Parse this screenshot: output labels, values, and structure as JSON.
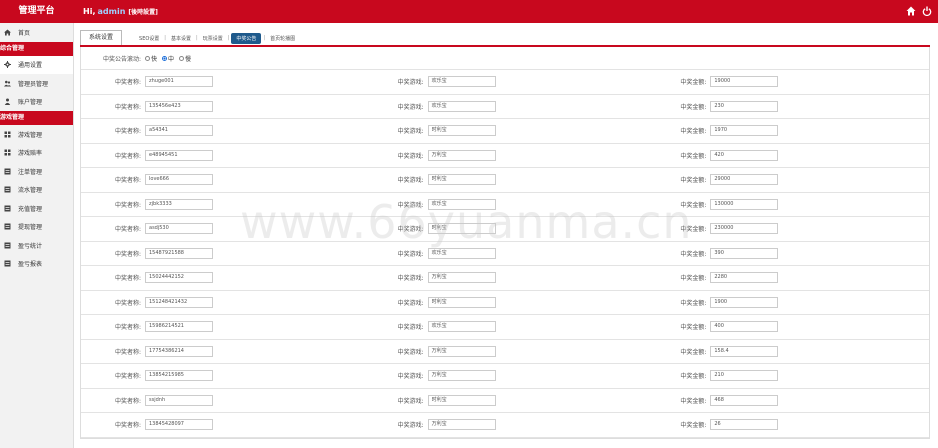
{
  "header": {
    "brand": "管理平台",
    "greet": "Hi,",
    "user": "admin",
    "role": "[後時設置]"
  },
  "sidebar": {
    "items": [
      {
        "label": "首页",
        "icon": "home-icon"
      },
      {
        "label": "综合管理",
        "head": true
      },
      {
        "label": "通用设置",
        "icon": "gear-icon",
        "active": true
      },
      {
        "label": "管理员管理",
        "icon": "users-icon"
      },
      {
        "label": "账户管理",
        "icon": "user-icon"
      },
      {
        "label": "游戏管理",
        "head": true
      },
      {
        "label": "游戏管理",
        "icon": "grid-icon"
      },
      {
        "label": "游戏赔率",
        "icon": "grid-icon"
      },
      {
        "label": "注单管理",
        "icon": "list-icon"
      },
      {
        "label": "流水管理",
        "icon": "list-icon"
      },
      {
        "label": "充值管理",
        "icon": "list-icon"
      },
      {
        "label": "提现管理",
        "icon": "list-icon"
      },
      {
        "label": "盈亏统计",
        "icon": "list-icon"
      },
      {
        "label": "盈亏报表",
        "icon": "list-icon"
      }
    ]
  },
  "tabs": {
    "main": "系统设置",
    "sub": [
      "SEO设置",
      "基本设置",
      "玩票设置",
      "中奖公告",
      "首页轮播图"
    ],
    "active_sub": 3
  },
  "toggle": {
    "label": "中奖公告滚动:",
    "options": [
      "快",
      "中",
      "慢"
    ],
    "selected": 1
  },
  "labels": {
    "name": "中奖者称:",
    "game": "中奖游戏:",
    "amount": "中奖金额:"
  },
  "rows": [
    {
      "name": "zhuge001",
      "game": "欢乐宝",
      "amount": "19000"
    },
    {
      "name": "135456e423",
      "game": "欢乐宝",
      "amount": "230"
    },
    {
      "name": "a54341",
      "game": "时利宝",
      "amount": "1970"
    },
    {
      "name": "e48945451",
      "game": "万利宝",
      "amount": "420"
    },
    {
      "name": "love666",
      "game": "时利宝",
      "amount": "29000"
    },
    {
      "name": "zjbk3333",
      "game": "欢乐宝",
      "amount": "130000"
    },
    {
      "name": "asdj530",
      "game": "时利宝",
      "amount": "230000"
    },
    {
      "name": "15487921588",
      "game": "欢乐宝",
      "amount": "390"
    },
    {
      "name": "15024442152",
      "game": "万利宝",
      "amount": "2280"
    },
    {
      "name": "151248421432",
      "game": "时利宝",
      "amount": "1900"
    },
    {
      "name": "15986214521",
      "game": "欢乐宝",
      "amount": "400"
    },
    {
      "name": "17754386214",
      "game": "万利宝",
      "amount": "158.4"
    },
    {
      "name": "13854215985",
      "game": "万利宝",
      "amount": "210"
    },
    {
      "name": "ssjdnh",
      "game": "时利宝",
      "amount": "468"
    },
    {
      "name": "13845428097",
      "game": "万利宝",
      "amount": "26"
    }
  ],
  "watermark": "www.66yuanma.cn"
}
